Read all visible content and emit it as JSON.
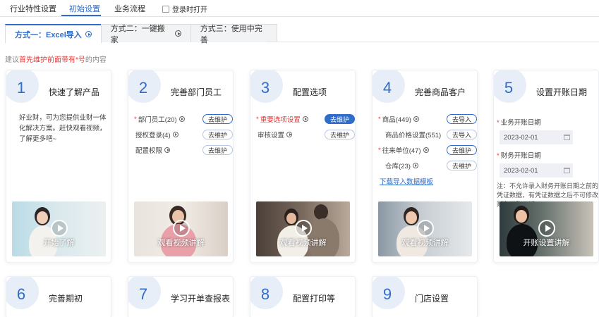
{
  "top_tabs": [
    {
      "label": "行业特性设置"
    },
    {
      "label": "初始设置"
    },
    {
      "label": "业务流程"
    }
  ],
  "login_open_label": "登录时打开",
  "method_tabs": [
    {
      "label": "方式一：Excel导入"
    },
    {
      "label": "方式二：一键搬家"
    },
    {
      "label": "方式三：使用中完善"
    }
  ],
  "hint": {
    "prefix": "建议",
    "highlight": "首先维护前面带有*号",
    "suffix": "的内容"
  },
  "steps": [
    {
      "num": "1",
      "title": "快速了解产品",
      "desc": "好业财，可为您提供业财一体化解决方案。赶快观看视频，了解更多吧~",
      "video_caption": "开始了解"
    },
    {
      "num": "2",
      "title": "完善部门员工",
      "rows": [
        {
          "required": "*",
          "label": "部门员工(20)",
          "button": "去维护"
        },
        {
          "required": "",
          "label": "授权登录(4)",
          "button": "去维护"
        },
        {
          "required": "",
          "label": "配置权限",
          "button": "去维护"
        }
      ],
      "video_caption": "观看视频讲解"
    },
    {
      "num": "3",
      "title": "配置选项",
      "rows": [
        {
          "required": "*",
          "label": "重要选项设置",
          "button": "去维护"
        },
        {
          "required": "",
          "label": "审核设置",
          "button": "去维护"
        }
      ],
      "video_caption": "观看视频讲解"
    },
    {
      "num": "4",
      "title": "完善商品客户",
      "rows": [
        {
          "required": "*",
          "label": "商品(449)",
          "button": "去导入"
        },
        {
          "required": "",
          "label": "商品价格设置(551)",
          "button": "去导入"
        },
        {
          "required": "*",
          "label": "往来单位(47)",
          "button": "去维护"
        },
        {
          "required": "",
          "label": "仓库(23)",
          "button": "去维护"
        }
      ],
      "link": "下载导入数据模板",
      "video_caption": "观看视频讲解"
    },
    {
      "num": "5",
      "title": "设置开账日期",
      "fields": [
        {
          "required": "*",
          "label": "业务开账日期",
          "value": "2023-02-01"
        },
        {
          "required": "*",
          "label": "财务开账日期",
          "value": "2023-02-01"
        }
      ],
      "note": "注：不允许录入财务开账日期之前的凭证数据，有凭证数据之后不可修改财务开账日期。",
      "video_caption": "开账设置讲解"
    },
    {
      "num": "6",
      "title": "完善期初"
    },
    {
      "num": "7",
      "title": "学习开单查报表"
    },
    {
      "num": "8",
      "title": "配置打印等"
    },
    {
      "num": "9",
      "title": "门店设置"
    }
  ],
  "colors": {
    "accent": "#2f6dc8",
    "required": "#e53a3a",
    "step_bubble": "#e8eef8"
  },
  "icons": [
    "play-circle-icon",
    "calendar-icon",
    "checkbox-icon"
  ]
}
